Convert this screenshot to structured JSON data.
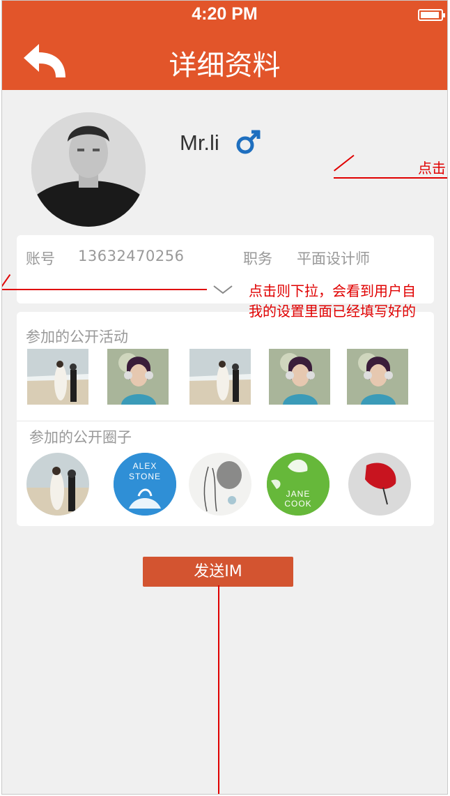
{
  "status_bar": {
    "time": "4:20 PM",
    "battery_icon": "battery-full-icon"
  },
  "nav": {
    "title": "详细资料",
    "back_icon": "back-arrow-icon"
  },
  "profile": {
    "name": "Mr.li",
    "gender_icon": "male-symbol-icon"
  },
  "info": {
    "account_label": "账号",
    "account_value": "13632470256",
    "position_label": "职务",
    "position_value": "平面设计师",
    "expand_icon": "chevron-down-icon"
  },
  "activities": {
    "title": "参加的公开活动",
    "items": [
      "wedding-beach-photo",
      "girl-headphones-photo",
      "wedding-beach-photo",
      "girl-headphones-photo",
      "girl-headphones-photo"
    ]
  },
  "circles": {
    "title": "参加的公开圈子",
    "items": [
      {
        "image": "wedding-beach-photo",
        "text_line1": "",
        "text_line2": ""
      },
      {
        "image": "alex-stone-logo",
        "text_line1": "ALEX",
        "text_line2": "STONE"
      },
      {
        "image": "fashion-sketch",
        "text_line1": "",
        "text_line2": ""
      },
      {
        "image": "jane-cook-logo",
        "text_line1": "JANE",
        "text_line2": "COOK"
      },
      {
        "image": "red-flower-photo",
        "text_line1": "",
        "text_line2": ""
      }
    ]
  },
  "send_button": {
    "label": "发送IM"
  },
  "annotations": {
    "right_top": "点击",
    "middle_line1": "点击则下拉，会看到用户自",
    "middle_line2": "我的设置里面已经填写好的"
  },
  "colors": {
    "header": "#e2552a",
    "button": "#d35430",
    "annotation": "#e00000",
    "background": "#f0f0f0"
  }
}
